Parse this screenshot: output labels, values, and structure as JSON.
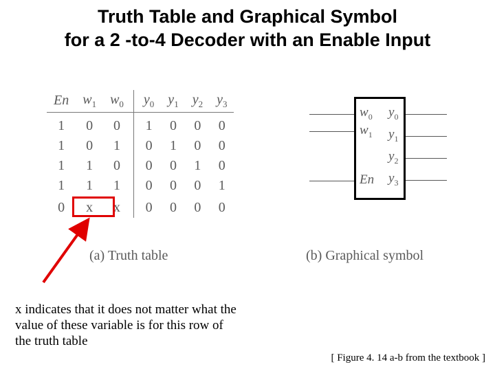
{
  "title_l1": "Truth Table and Graphical Symbol",
  "title_l2": "for a 2 -to-4 Decoder with an Enable Input",
  "truth_table": {
    "headers": {
      "en": "En",
      "w1": "w",
      "w1s": "1",
      "w0": "w",
      "w0s": "0",
      "y0": "y",
      "y0s": "0",
      "y1": "y",
      "y1s": "1",
      "y2": "y",
      "y2s": "2",
      "y3": "y",
      "y3s": "3"
    },
    "rows": [
      {
        "en": "1",
        "w1": "0",
        "w0": "0",
        "y0": "1",
        "y1": "0",
        "y2": "0",
        "y3": "0"
      },
      {
        "en": "1",
        "w1": "0",
        "w0": "1",
        "y0": "0",
        "y1": "1",
        "y2": "0",
        "y3": "0"
      },
      {
        "en": "1",
        "w1": "1",
        "w0": "0",
        "y0": "0",
        "y1": "0",
        "y2": "1",
        "y3": "0"
      },
      {
        "en": "1",
        "w1": "1",
        "w0": "1",
        "y0": "0",
        "y1": "0",
        "y2": "0",
        "y3": "1"
      },
      {
        "en": "0",
        "w1": "x",
        "w0": "x",
        "y0": "0",
        "y1": "0",
        "y2": "0",
        "y3": "0"
      }
    ]
  },
  "caption_a": "(a) Truth table",
  "caption_b": "(b) Graphical symbol",
  "symbol": {
    "w0": "w",
    "w0s": "0",
    "w1": "w",
    "w1s": "1",
    "en": "En",
    "y0": "y",
    "y0s": "0",
    "y1": "y",
    "y1s": "1",
    "y2": "y",
    "y2s": "2",
    "y3": "y",
    "y3s": "3"
  },
  "note": "x indicates that it does not matter what the value of these variable is for this row of the truth table",
  "cite": "[ Figure 4. 14 a-b from the textbook ]",
  "chart_data": {
    "type": "table",
    "title": "2-to-4 Decoder with Enable — Truth Table",
    "columns": [
      "En",
      "w1",
      "w0",
      "y0",
      "y1",
      "y2",
      "y3"
    ],
    "rows": [
      [
        1,
        0,
        0,
        1,
        0,
        0,
        0
      ],
      [
        1,
        0,
        1,
        0,
        1,
        0,
        0
      ],
      [
        1,
        1,
        0,
        0,
        0,
        1,
        0
      ],
      [
        1,
        1,
        1,
        0,
        0,
        0,
        1
      ],
      [
        0,
        "x",
        "x",
        0,
        0,
        0,
        0
      ]
    ],
    "note_on_x": "x = don't-care"
  }
}
